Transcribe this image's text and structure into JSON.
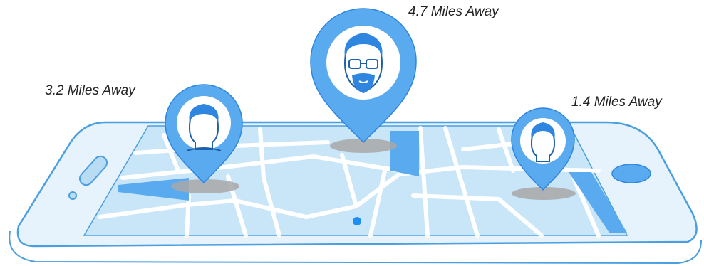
{
  "colors": {
    "phone_fill": "#e6f3fc",
    "phone_outline": "#4a9fe0",
    "map_fill": "#c9e5f8",
    "road": "#ffffff",
    "accent": "#5aaaf0",
    "accent_dark": "#2e86e0",
    "pin_shadow": "#a8a8a8",
    "user_dot": "#1e8ef5",
    "label_text": "#222222"
  },
  "pins": [
    {
      "id": "left",
      "label": "3.2 Miles Away",
      "avatar": "man-short-hair-icon"
    },
    {
      "id": "center",
      "label": "4.7 Miles Away",
      "avatar": "man-glasses-beard-icon"
    },
    {
      "id": "right",
      "label": "1.4 Miles Away",
      "avatar": "man-short-hair-icon"
    }
  ]
}
